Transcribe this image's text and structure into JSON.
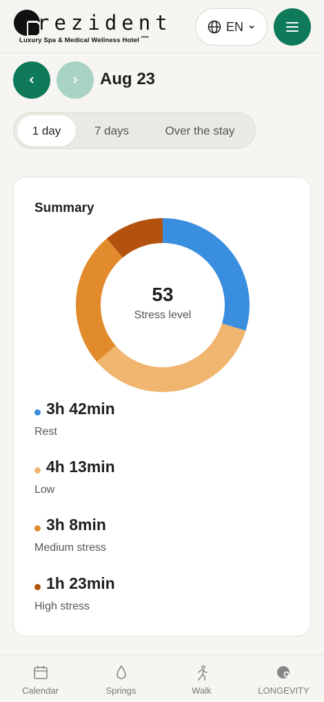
{
  "header": {
    "logo_word": "rezident",
    "logo_subtitle": "Luxury Spa & Medical Wellness Hotel",
    "logo_stars": "****",
    "language": "EN"
  },
  "date_nav": {
    "date": "Aug 23"
  },
  "range_tabs": [
    {
      "label": "1 day",
      "active": true
    },
    {
      "label": "7 days",
      "active": false
    },
    {
      "label": "Over the stay",
      "active": false
    }
  ],
  "summary": {
    "title": "Summary",
    "stress_value": "53",
    "stress_label": "Stress level"
  },
  "chart_data": {
    "type": "pie",
    "donut": true,
    "categories": [
      "Rest",
      "Low",
      "Medium stress",
      "High stress"
    ],
    "values_minutes": [
      222,
      253,
      188,
      83
    ],
    "colors": [
      "#3a8ee0",
      "#f0b56e",
      "#e18b2c",
      "#b3520e"
    ]
  },
  "legend": [
    {
      "value": "3h 42min",
      "label": "Rest",
      "color": "#3a8ee0"
    },
    {
      "value": "4h 13min",
      "label": "Low",
      "color": "#f0b56e"
    },
    {
      "value": "3h 8min",
      "label": "Medium stress",
      "color": "#e18b2c"
    },
    {
      "value": "1h 23min",
      "label": "High stress",
      "color": "#b3520e"
    }
  ],
  "bottom_nav": [
    {
      "label": "Calendar",
      "icon": "calendar-icon"
    },
    {
      "label": "Springs",
      "icon": "water-drop-icon"
    },
    {
      "label": "Walk",
      "icon": "walking-person-icon"
    },
    {
      "label": "LONGEVITY",
      "icon": "longevity-logo-icon"
    }
  ],
  "colors": {
    "accent": "#0f7a5a",
    "accent_disabled": "#a8d2c4",
    "background": "#f6f5f1"
  }
}
